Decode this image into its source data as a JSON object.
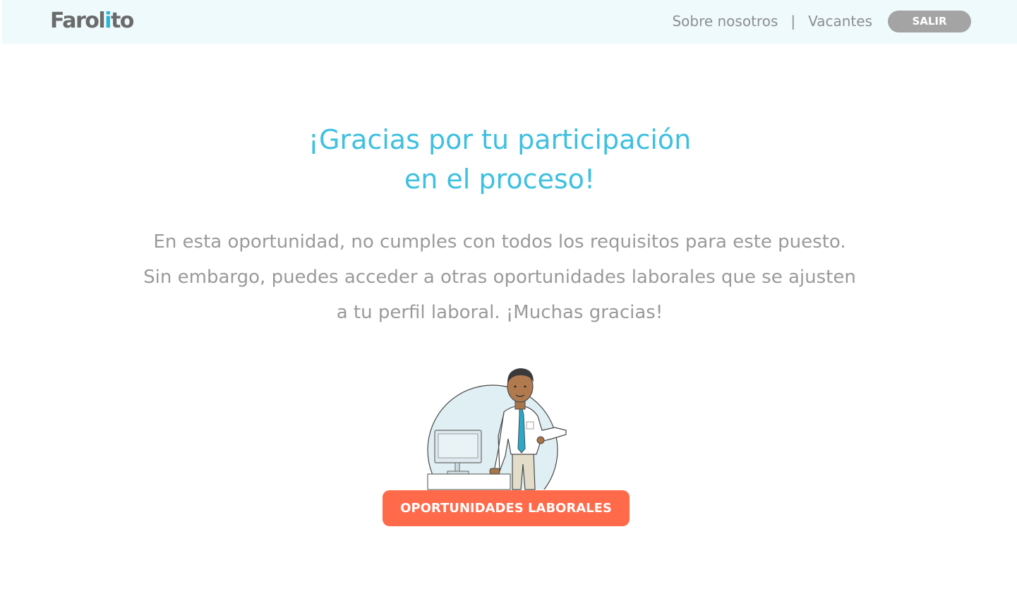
{
  "header": {
    "logo_text_a": "Farol",
    "logo_text_b": "i",
    "logo_text_c": "to",
    "nav": {
      "about": "Sobre nosotros",
      "separator": "|",
      "jobs": "Vacantes"
    },
    "logout_label": "SALIR"
  },
  "main": {
    "title_line1": "¡Gracias por tu participación",
    "title_line2": "en el proceso!",
    "message": "En esta oportunidad, no cumples con todos los requisitos para este puesto. Sin embargo, puedes acceder a otras oportunidades laborales que se ajusten a tu perfil laboral. ¡Muchas gracias!",
    "cta_label": "OPORTUNIDADES LABORALES"
  },
  "colors": {
    "header_bg": "#eefafc",
    "title": "#3ec0e0",
    "text": "#9a9a9a",
    "cta": "#ff6a4a",
    "logout": "#a4a4a4"
  },
  "icons": {
    "illustration": "businessman-at-desk-illustration"
  }
}
